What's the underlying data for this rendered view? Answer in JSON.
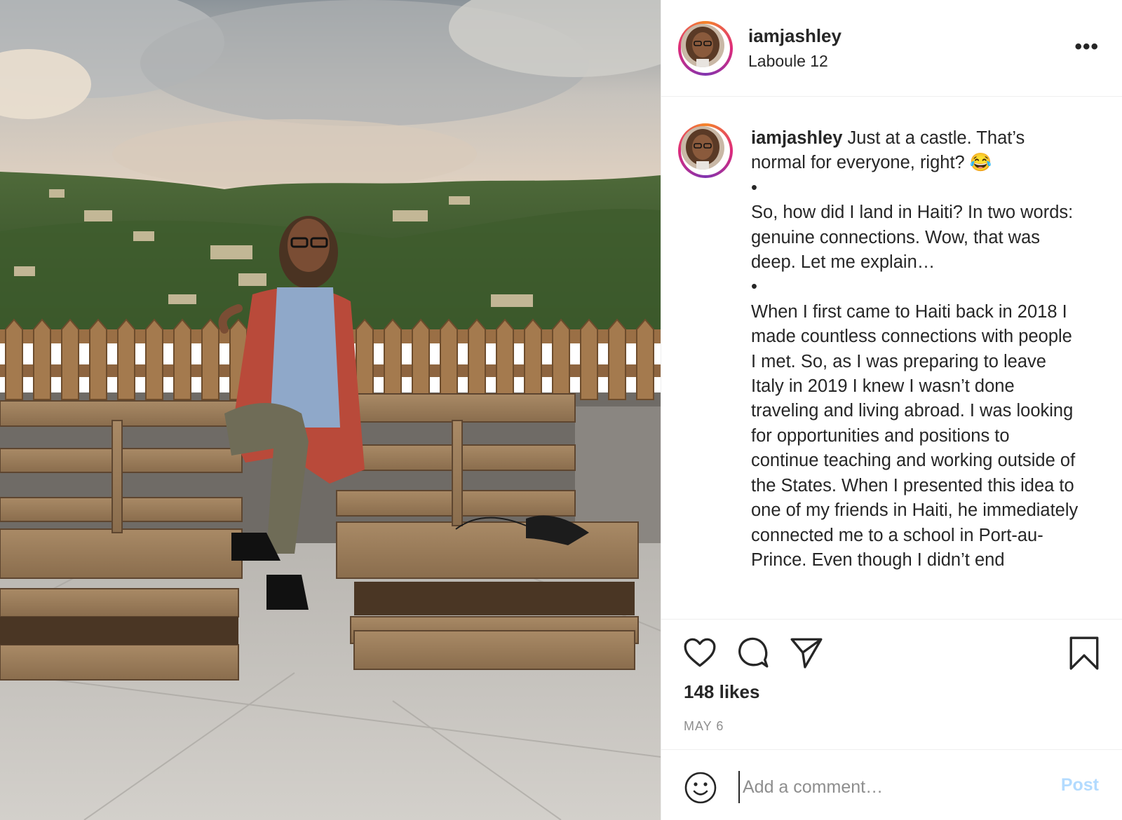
{
  "post": {
    "username": "iamjashley",
    "location": "Laboule 12",
    "more_label": "•••",
    "caption": {
      "username": "iamjashley",
      "intro": "Just at a castle. That’s normal for everyone, right? 😂",
      "bullet1": "•",
      "para1": "So, how did I land in Haiti? In two words: genuine connections. Wow, that was deep. Let me explain…",
      "bullet2": "•",
      "para2": "When I first came to Haiti back in 2018 I made countless connections with people I met. So, as I was preparing to leave Italy in 2019 I knew I wasn’t done traveling and living abroad. I was looking for opportunities and positions to continue teaching and working outside of the States. When I presented this idea to one of my friends in Haiti, he immediately connected me to a school in Port-au-Prince. Even though I didn’t end"
    },
    "likes": "148 likes",
    "date": "MAY 6",
    "comment": {
      "placeholder": "Add a comment…",
      "post_label": "Post"
    }
  },
  "icons": {
    "like": "heart-icon",
    "comment": "comment-bubble-icon",
    "share": "paper-plane-icon",
    "save": "bookmark-icon",
    "emoji": "smiley-icon"
  },
  "colors": {
    "text": "#262626",
    "secondary": "#8e8e8e",
    "post_button": "#b3dbff",
    "divider": "#efefef"
  }
}
